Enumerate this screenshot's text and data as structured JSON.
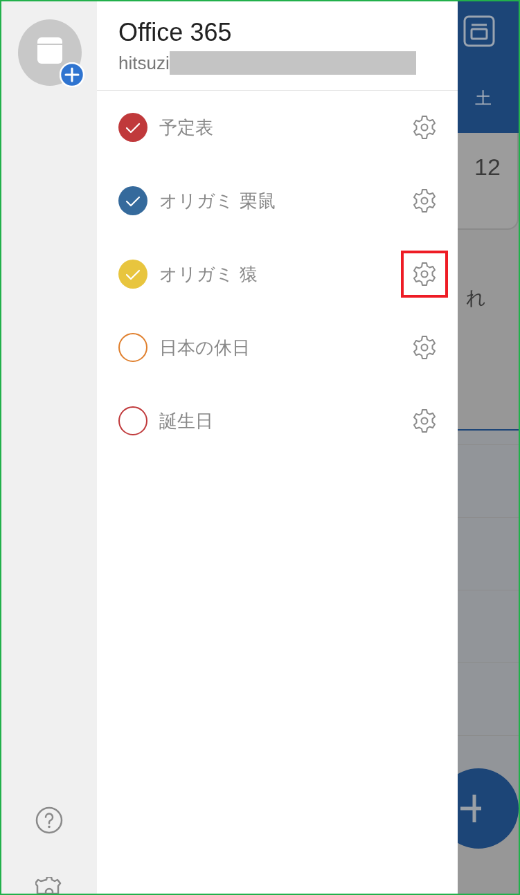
{
  "account": {
    "title": "Office 365",
    "email": "hitsuzi"
  },
  "calendars": [
    {
      "name": "予定表",
      "checked": true,
      "color": "#c0393b",
      "highlighted": false
    },
    {
      "name": "オリガミ 栗鼠",
      "checked": true,
      "color": "#356a9c",
      "highlighted": false
    },
    {
      "name": "オリガミ 猿",
      "checked": true,
      "color": "#e8c53e",
      "highlighted": true
    },
    {
      "name": "日本の休日",
      "checked": false,
      "color": "#e07f2c",
      "highlighted": false
    },
    {
      "name": "誕生日",
      "checked": false,
      "color": "#c0393b",
      "highlighted": false
    }
  ],
  "background": {
    "weekday": "土",
    "date": "12",
    "snippet": "れ"
  }
}
